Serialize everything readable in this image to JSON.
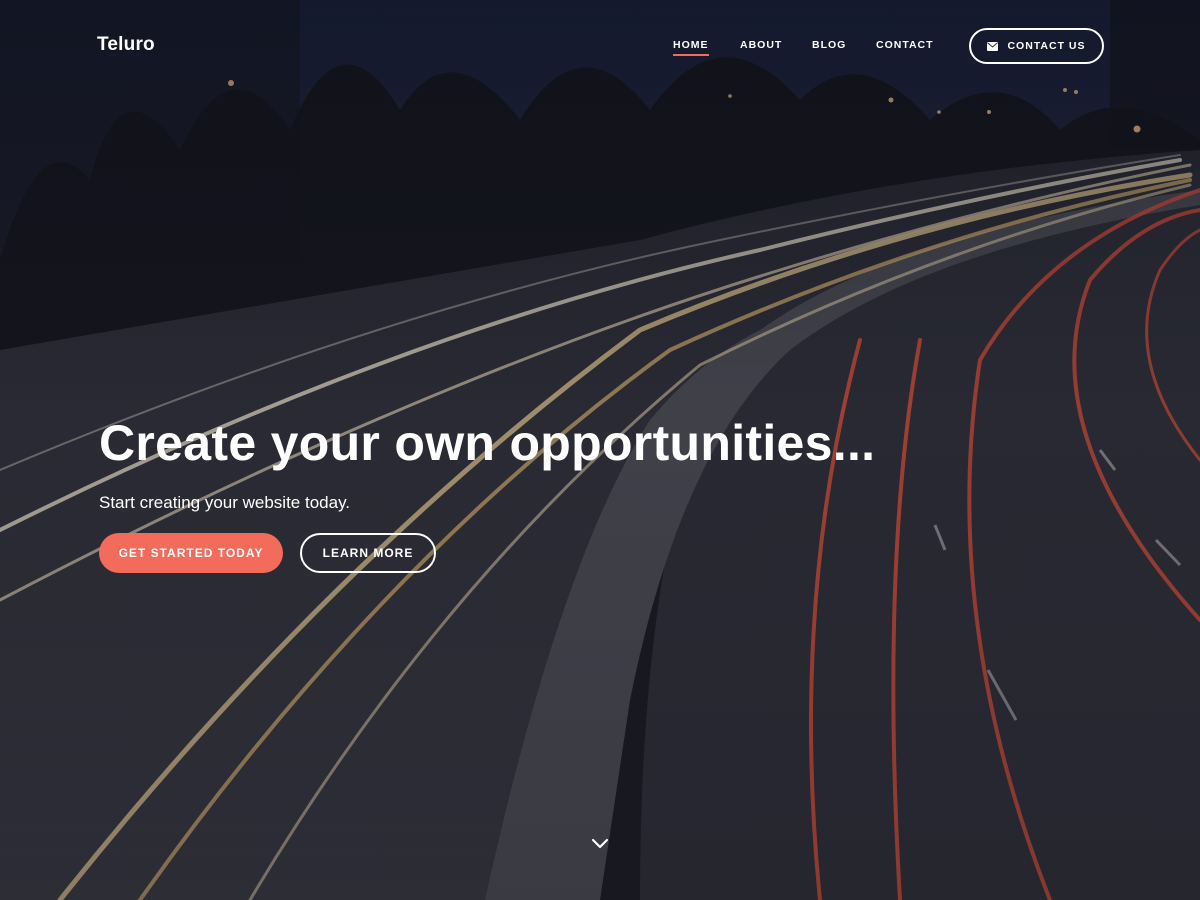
{
  "site": {
    "title": "Teluro"
  },
  "nav": {
    "items": [
      {
        "label": "HOME",
        "active": true
      },
      {
        "label": "ABOUT",
        "active": false
      },
      {
        "label": "BLOG",
        "active": false
      },
      {
        "label": "CONTACT",
        "active": false
      }
    ],
    "contact_button": {
      "label": "CONTACT US",
      "icon": "envelope-icon"
    }
  },
  "hero": {
    "headline": "Create your own opportunities...",
    "subheadline": "Start creating your website today.",
    "primary_button": "GET STARTED TODAY",
    "secondary_button": "LEARN MORE",
    "scroll_icon": "chevron-down-icon"
  },
  "colors": {
    "accent": "#f26b5b",
    "text": "#ffffff",
    "background": "#1a1b22"
  }
}
